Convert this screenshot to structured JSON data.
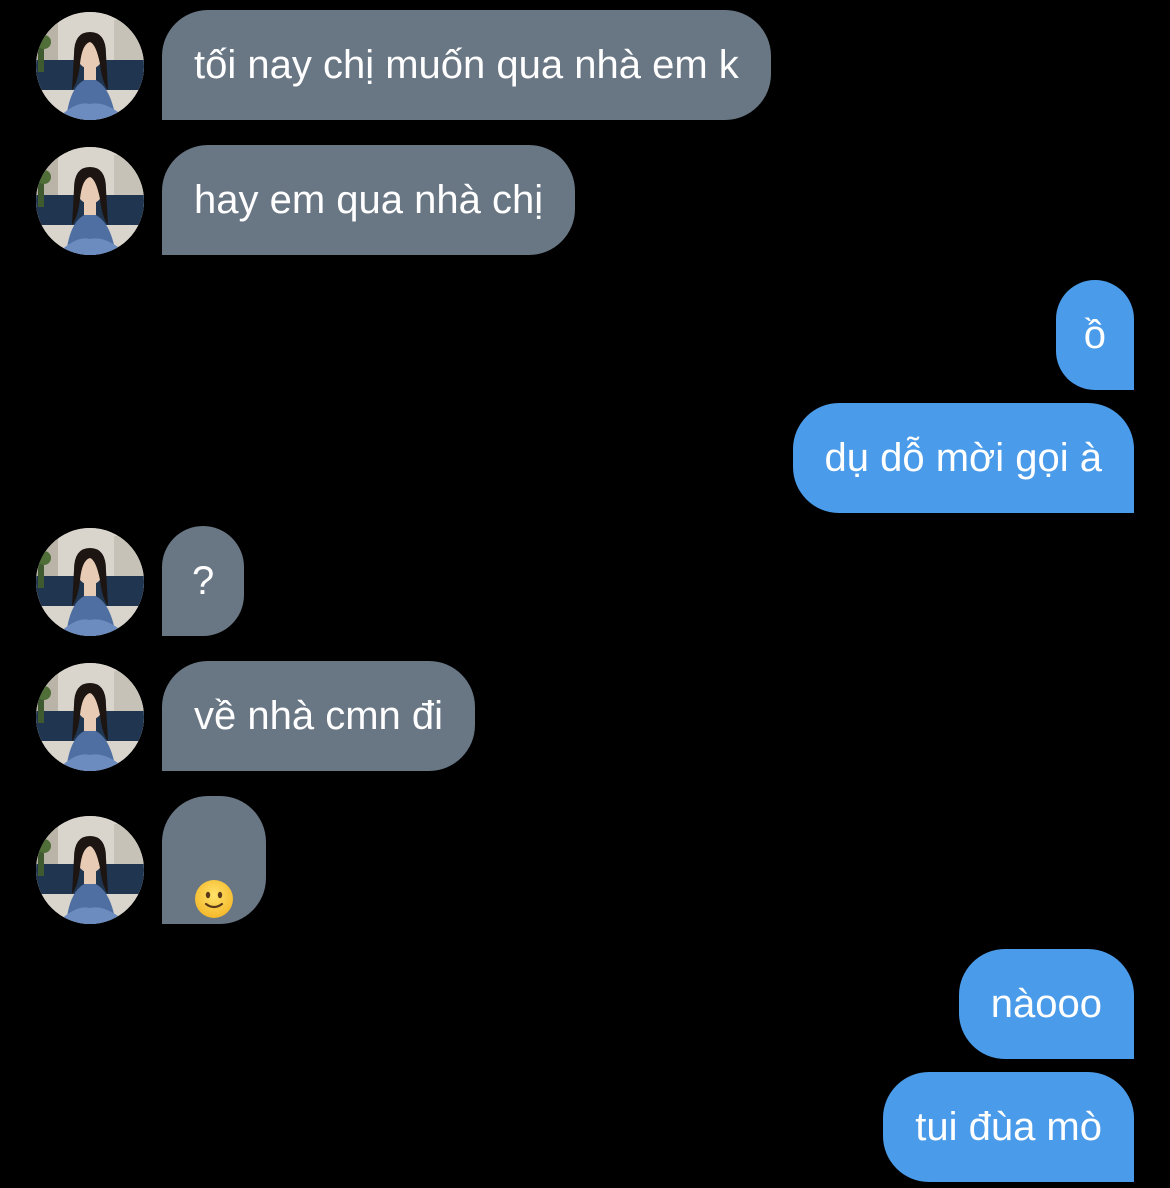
{
  "contact": {
    "avatar_icon": "profile-photo-avatar"
  },
  "colors": {
    "background": "#000000",
    "incoming_bubble": "#697684",
    "outgoing_bubble": "#4a9be9",
    "text": "#ffffff"
  },
  "messages": [
    {
      "direction": "incoming",
      "text": "tối nay chị muốn qua nhà em k"
    },
    {
      "direction": "incoming",
      "text": "hay em qua nhà chị"
    },
    {
      "direction": "outgoing",
      "text": "ồ"
    },
    {
      "direction": "outgoing",
      "text": "dụ dỗ mời gọi à"
    },
    {
      "direction": "incoming",
      "text": "?"
    },
    {
      "direction": "incoming",
      "text": "về nhà cmn đi"
    },
    {
      "direction": "incoming",
      "text": "",
      "emoji": "slightly-smiling-face-icon"
    },
    {
      "direction": "outgoing",
      "text": "nàooo"
    },
    {
      "direction": "outgoing",
      "text": "tui đùa mò"
    }
  ]
}
